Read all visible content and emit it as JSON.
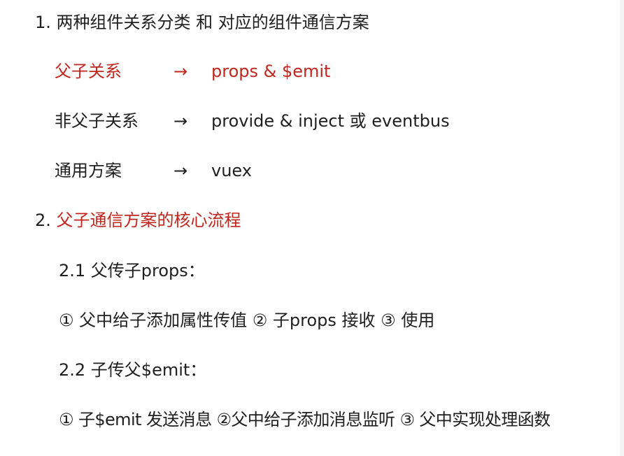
{
  "section1": {
    "heading": "1. 两种组件关系分类  和  对应的组件通信方案",
    "rows": [
      {
        "relation": "父子关系",
        "arrow": "→",
        "solution": "props & $emit",
        "highlight": true
      },
      {
        "relation": "非父子关系",
        "arrow": "→",
        "solution": "provide & inject   或  eventbus",
        "highlight": false
      },
      {
        "relation": "通用方案",
        "arrow": "→",
        "solution": "vuex",
        "highlight": false
      }
    ]
  },
  "section2": {
    "number": "2.",
    "title": "父子通信方案的核心流程",
    "sub1_title": "2.1 父传子props：",
    "sub1_steps": "①  父中给子添加属性传值   ② 子props 接收   ③ 使用",
    "sub2_title": "2.2 子传父$emit：",
    "sub2_steps": "① 子$emit 发送消息 ②父中给子添加消息监听 ③ 父中实现处理函数"
  },
  "colors": {
    "accent_red": "#c0261d",
    "text": "#1f1f1f",
    "background": "#ffffff"
  }
}
